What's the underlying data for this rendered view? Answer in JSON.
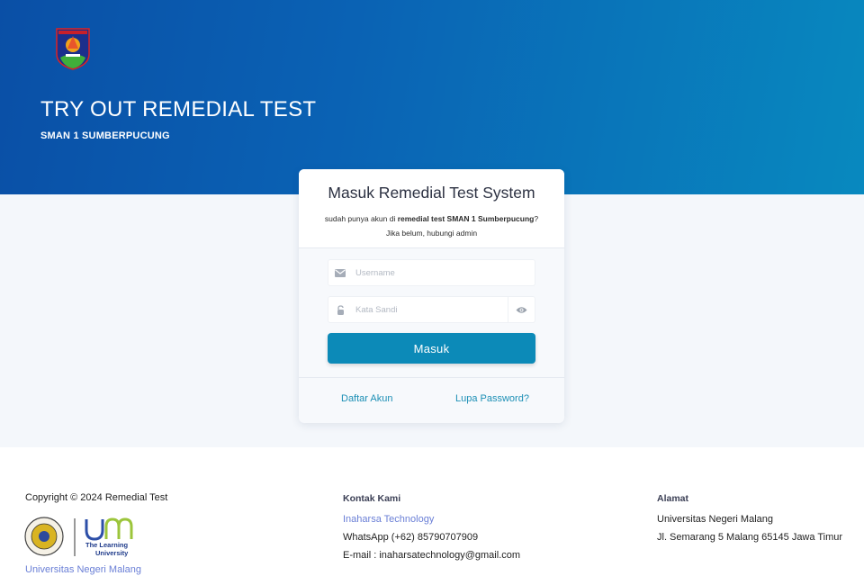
{
  "hero": {
    "title": "TRY OUT REMEDIAL TEST",
    "subtitle": "SMAN 1 SUMBERPUCUNG"
  },
  "login": {
    "title": "Masuk Remedial Test System",
    "desc_prefix": "sudah punya akun di ",
    "desc_bold": "remedial test SMAN 1 Sumberpucung",
    "desc_suffix": "?",
    "desc_line2": "Jika belum, hubungi admin",
    "username_placeholder": "Username",
    "password_placeholder": "Kata Sandi",
    "submit_label": "Masuk",
    "register_link": "Daftar Akun",
    "forgot_link": "Lupa Password?"
  },
  "footer": {
    "copyright": "Copyright © 2024 Remedial Test",
    "logo_caption_line1": "The Learning",
    "logo_caption_line2": "University",
    "university_name": "Universitas Negeri Malang",
    "contact_heading": "Kontak Kami",
    "contact_company": "Inaharsa Technology",
    "contact_whatsapp": "WhatsApp (+62) 85790707909",
    "contact_email": "E-mail : inaharsatechnology@gmail.com",
    "address_heading": "Alamat",
    "address_line1": "Universitas Negeri Malang",
    "address_line2": "Jl. Semarang 5 Malang 65145 Jawa Timur"
  },
  "colors": {
    "hero_start": "#0a4fa6",
    "hero_end": "#0889bf",
    "button": "#0c8ab8",
    "link": "#1c8fb5",
    "footer_link": "#6a7fd6"
  },
  "icons": [
    "school-emblem-icon",
    "envelope-icon",
    "lock-icon",
    "eye-icon",
    "um-university-logo"
  ]
}
